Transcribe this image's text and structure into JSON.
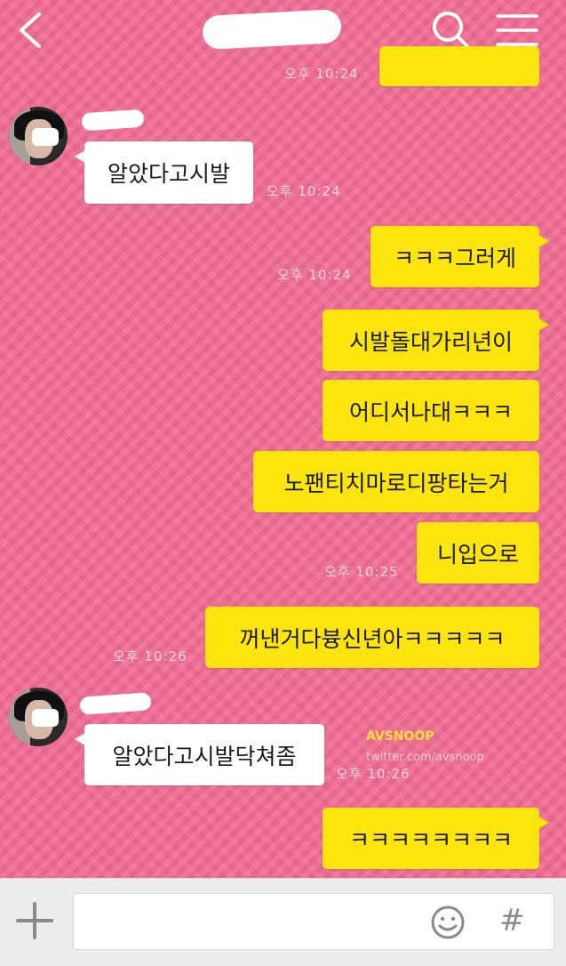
{
  "header": {
    "back_icon": "chevron-left-icon",
    "search_icon": "search-icon",
    "menu_icon": "hamburger-menu-icon"
  },
  "messages": [
    {
      "from": "me",
      "time": "오후 10:24"
    },
    {
      "from": "them",
      "text": "알았다고시발",
      "time": "오후 10:24"
    },
    {
      "from": "me",
      "text": "ㅋㅋㅋ그러게",
      "time": "오후 10:24"
    },
    {
      "from": "me",
      "text": "시발돌대가리년이"
    },
    {
      "from": "me",
      "text": "어디서나대ㅋㅋㅋ"
    },
    {
      "from": "me",
      "text": "노팬티치마로디팡타는거"
    },
    {
      "from": "me",
      "text": "니입으로",
      "time": "오후 10:25"
    },
    {
      "from": "me",
      "text": "꺼낸거다븅신년아ㅋㅋㅋㅋㅋ",
      "time": "오후 10:26"
    },
    {
      "from": "them",
      "text": "알았다고시발닥쳐좀",
      "time": "오후 10:26"
    },
    {
      "from": "me",
      "text": "ㅋㅋㅋㅋㅋㅋㅋㅋ"
    }
  ],
  "watermark": {
    "brand": "AVSNOOP",
    "handle": "twitter.com/avsnoop"
  },
  "input_bar": {
    "plus_icon": "plus-icon",
    "emoji_icon": "smiley-icon",
    "hash_label": "#",
    "placeholder": ""
  },
  "colors": {
    "background": "#f06c93",
    "my_bubble": "#fbe50c",
    "their_bubble": "#ffffff",
    "input_bar": "#ececec"
  }
}
